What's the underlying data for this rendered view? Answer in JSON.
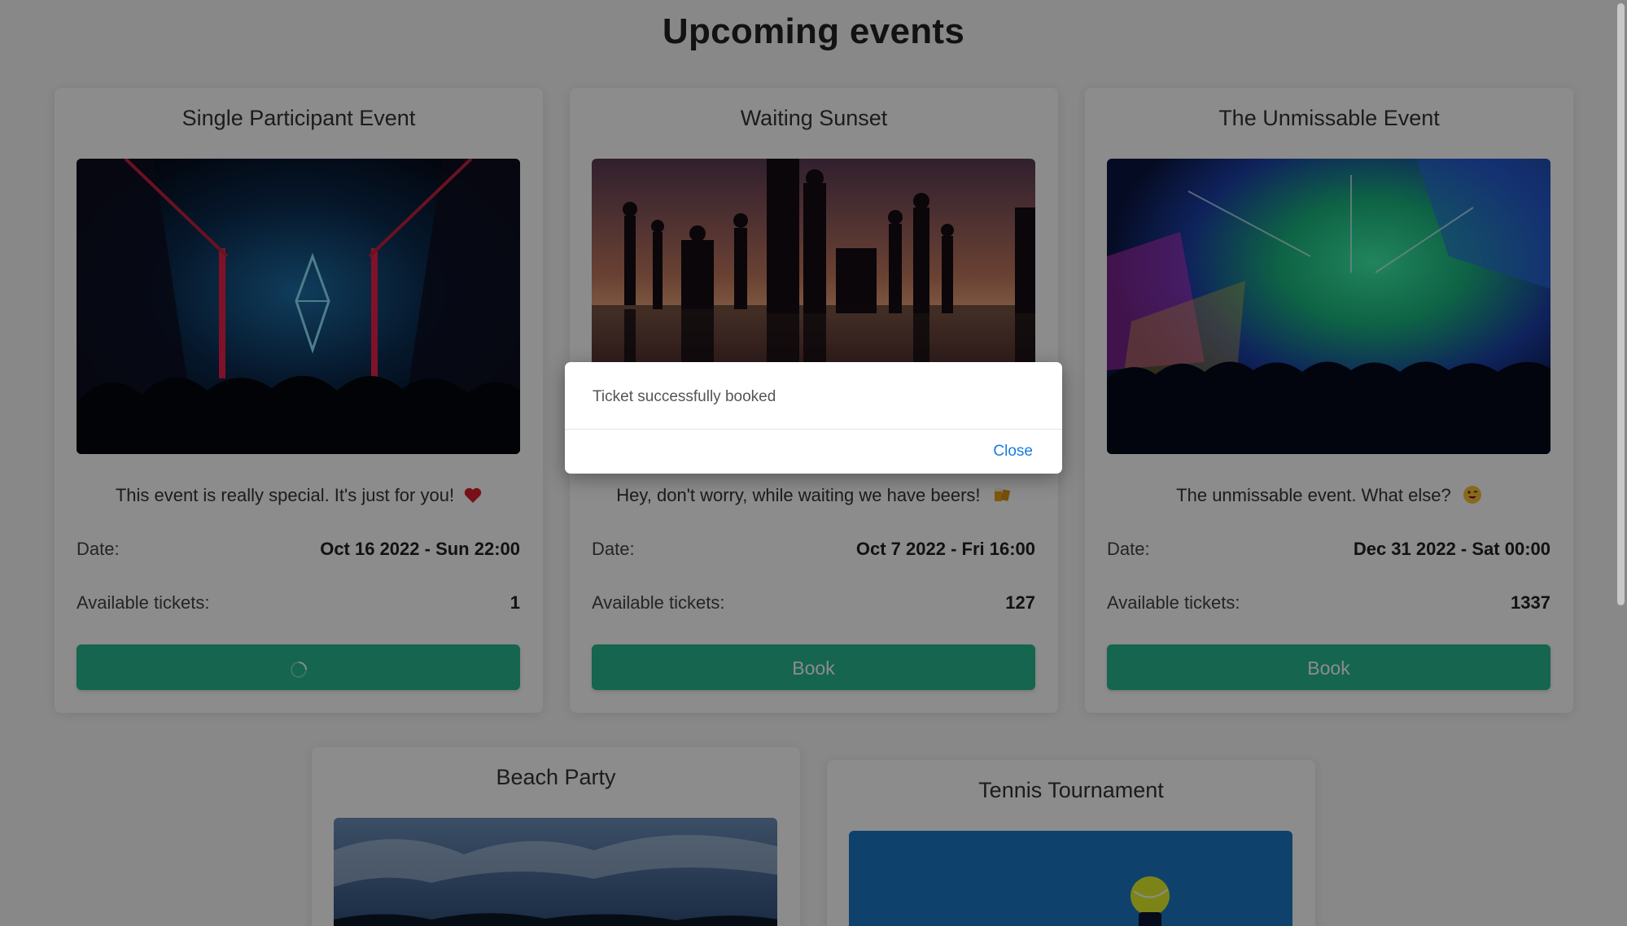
{
  "page": {
    "title": "Upcoming events"
  },
  "events": [
    {
      "title": "Single Participant Event",
      "image": "neon-crystal-stage",
      "description": "This event is really special. It's just for you!",
      "description_icon": "heart-icon",
      "date_label": "Date:",
      "date": "Oct 16 2022 - Sun 22:00",
      "tickets_label": "Available tickets:",
      "tickets": "1",
      "button_state": "loading",
      "button_label": ""
    },
    {
      "title": "Waiting Sunset",
      "image": "sunset-silhouettes",
      "description": "Hey, don't worry, while waiting we have beers!",
      "description_icon": "beers-icon",
      "date_label": "Date:",
      "date": "Oct 7 2022 - Fri 16:00",
      "tickets_label": "Available tickets:",
      "tickets": "127",
      "button_label": "Book"
    },
    {
      "title": "The Unmissable Event",
      "image": "concert-lights-crowd",
      "description": "The unmissable event. What else?",
      "description_icon": "winking-face-icon",
      "date_label": "Date:",
      "date": "Dec 31 2022 - Sat 00:00",
      "tickets_label": "Available tickets:",
      "tickets": "1337",
      "button_label": "Book"
    },
    {
      "title": "Beach Party",
      "image": "beach-night-sky"
    },
    {
      "title": "Tennis Tournament",
      "image": "tennis-ball-court"
    }
  ],
  "modal": {
    "message": "Ticket successfully booked",
    "close_label": "Close"
  },
  "colors": {
    "accent": "#27b991",
    "link": "#1a7bdc",
    "overlay": "rgba(0,0,0,0.45)"
  }
}
